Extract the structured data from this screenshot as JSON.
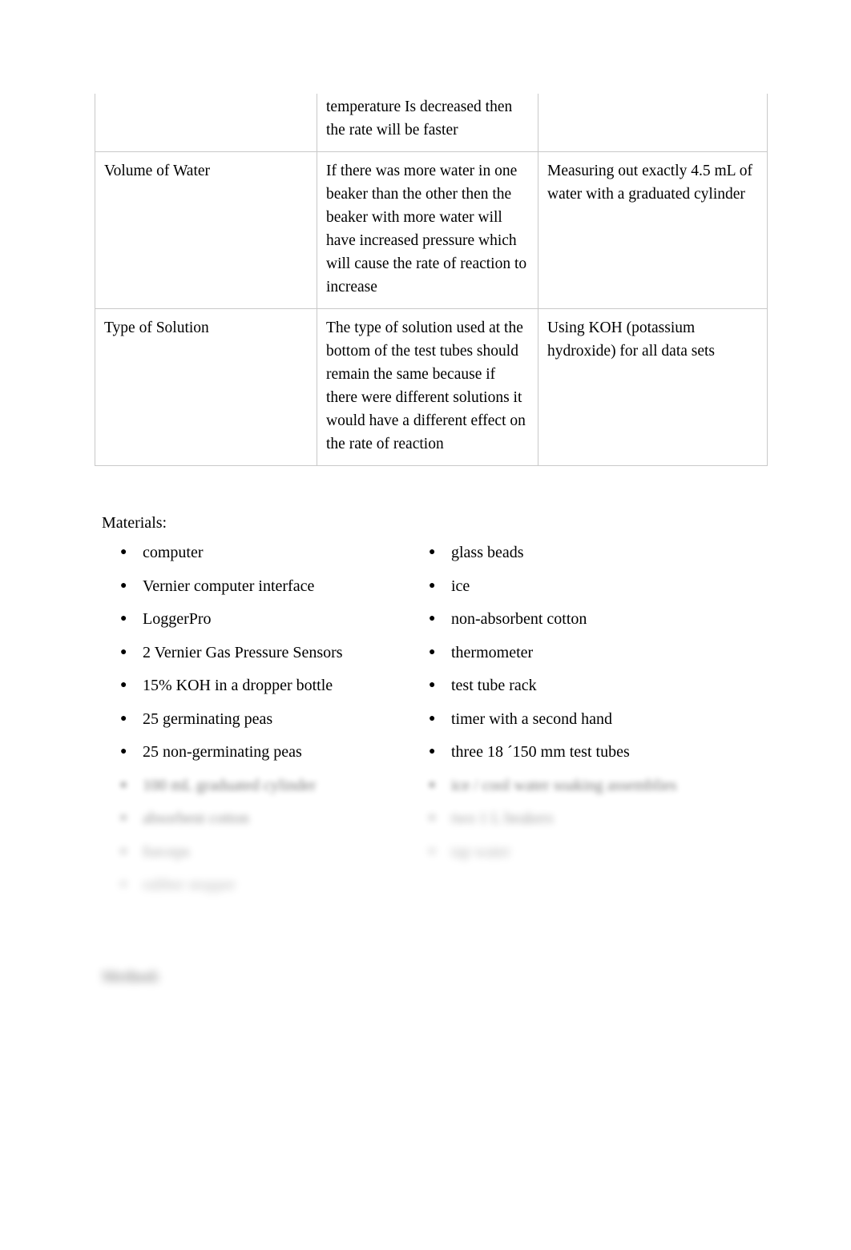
{
  "document": {
    "table": {
      "rows": [
        {
          "clipped": true,
          "variable": "",
          "explanation": "temperature Is decreased then the rate will be faster",
          "control": ""
        },
        {
          "clipped": false,
          "variable": "Volume of Water",
          "explanation": "If there was more water in one beaker than the other then the beaker with more water will have increased pressure which will cause the rate of reaction to increase",
          "control": "Measuring out exactly 4.5 mL of water with a graduated cylinder"
        },
        {
          "clipped": false,
          "variable": "Type of Solution",
          "explanation": "The type of solution used at the bottom of the test tubes should remain the same because if there were different solutions it would have a different effect on the rate of reaction",
          "control": "Using KOH (potassium hydroxide) for all data sets"
        }
      ]
    },
    "materials": {
      "heading": "Materials:",
      "bullet_glyph": "●",
      "left_column": [
        {
          "label": "computer",
          "blur": 0
        },
        {
          "label": "Vernier computer interface",
          "blur": 0
        },
        {
          "label": "LoggerPro",
          "blur": 0
        },
        {
          "label": "2 Vernier Gas Pressure Sensors",
          "blur": 0
        },
        {
          "label": "15% KOH in a dropper bottle",
          "blur": 0
        },
        {
          "label": "25 germinating peas",
          "blur": 0
        },
        {
          "label": "25 non-germinating peas",
          "blur": 0
        },
        {
          "label": "100 mL graduated cylinder",
          "blur": 2
        },
        {
          "label": "absorbent cotton",
          "blur": 3
        },
        {
          "label": "forceps",
          "blur": 4
        },
        {
          "label": "rubber stopper",
          "blur": 5
        }
      ],
      "right_column": [
        {
          "label": "glass beads",
          "blur": 0
        },
        {
          "label": "ice",
          "blur": 0
        },
        {
          "label": "non-absorbent cotton",
          "blur": 0
        },
        {
          "label": "thermometer",
          "blur": 0
        },
        {
          "label": "test tube rack",
          "blur": 0
        },
        {
          "label": "timer with a second hand",
          "blur": 0
        },
        {
          "label": "three 18 ´150 mm test tubes",
          "blur": 0
        },
        {
          "label": "ice / cool water soaking assemblies",
          "blur": 2
        },
        {
          "label": "two 1 L beakers",
          "blur": 4
        },
        {
          "label": "tap water",
          "blur": 5
        }
      ]
    },
    "next_section_heading": "Method:"
  }
}
